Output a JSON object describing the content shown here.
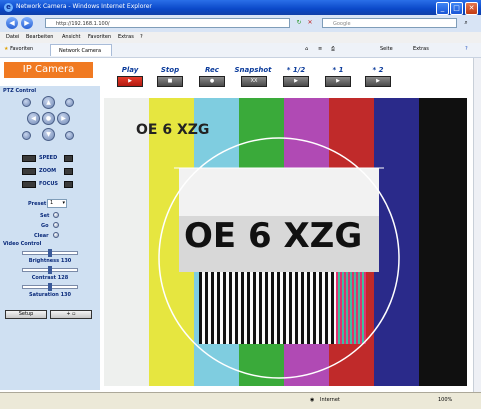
{
  "window": {
    "title": "Network Camera - Windows Internet Explorer",
    "minimize_glyph": "_",
    "maximize_glyph": "□",
    "close_glyph": "✕"
  },
  "address_bar": {
    "url": "http://192.168.1.100/",
    "search_placeholder": "Google",
    "back_glyph": "◀",
    "forward_glyph": "▶"
  },
  "menu": [
    "Datei",
    "Bearbeiten",
    "Ansicht",
    "Favoriten",
    "Extras",
    "?"
  ],
  "favorites": {
    "label": "Favoriten",
    "tab_label": "Network Camera",
    "tools": [
      "Seite",
      "Extras"
    ]
  },
  "page": {
    "brand": "IP Camera",
    "controls": [
      {
        "label": "Play",
        "glyph": "▶"
      },
      {
        "label": "Stop",
        "glyph": "■"
      },
      {
        "label": "Rec",
        "glyph": "●"
      },
      {
        "label": "Snapshot",
        "glyph": "XX"
      },
      {
        "label": "* 1/2",
        "glyph": "▶"
      },
      {
        "label": "* 1",
        "glyph": "▶"
      },
      {
        "label": "* 2",
        "glyph": "▶"
      }
    ],
    "ptz": {
      "title": "PTZ Control",
      "rows": [
        "SPEED",
        "ZOOM",
        "FOCUS"
      ],
      "preset_label": "Preset",
      "preset_value": "1",
      "set_label": "Set",
      "go_label": "Go",
      "clear_label": "Clear"
    },
    "video_control": {
      "title": "Video Control",
      "brightness_label": "Brightness 130",
      "contrast_label": "Contrast 128",
      "saturation_label": "Saturation 130",
      "brightness": 130,
      "contrast": 128,
      "saturation": 130
    },
    "setup_label": "Setup",
    "osd_small": "OE 6 XZG",
    "osd_large": "OE 6 XZG",
    "colors": {
      "brand_orange": "#f07a22",
      "panel_blue": "#cfe0f2",
      "control_label": "#0a3a9a"
    }
  },
  "status": {
    "left": "",
    "zone": "Internet",
    "zoom": "100%"
  }
}
